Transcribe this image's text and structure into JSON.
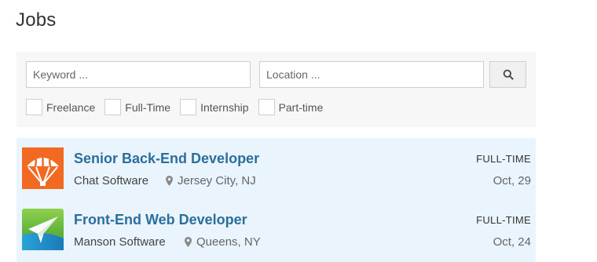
{
  "page": {
    "title": "Jobs"
  },
  "search": {
    "keyword_placeholder": "Keyword ...",
    "keyword_value": "",
    "location_placeholder": "Location ...",
    "location_value": "",
    "button_icon": "search-icon"
  },
  "filters": [
    {
      "label": "Freelance",
      "checked": false
    },
    {
      "label": "Full-Time",
      "checked": false
    },
    {
      "label": "Internship",
      "checked": false
    },
    {
      "label": "Part-time",
      "checked": false
    }
  ],
  "jobs": [
    {
      "title": "Senior Back-End Developer",
      "company": "Chat Software",
      "location": "Jersey City, NJ",
      "type": "FULL-TIME",
      "date": "Oct, 29",
      "logo": "parachute-logo",
      "logo_color": "#f26a21"
    },
    {
      "title": "Front-End Web Developer",
      "company": "Manson Software",
      "location": "Queens, NY",
      "type": "FULL-TIME",
      "date": "Oct, 24",
      "logo": "plane-logo",
      "logo_color": "#5cb531"
    }
  ],
  "colors": {
    "link": "#2a6f9c",
    "list_background": "#eaf4fc",
    "panel_background": "#f7f7f7"
  }
}
